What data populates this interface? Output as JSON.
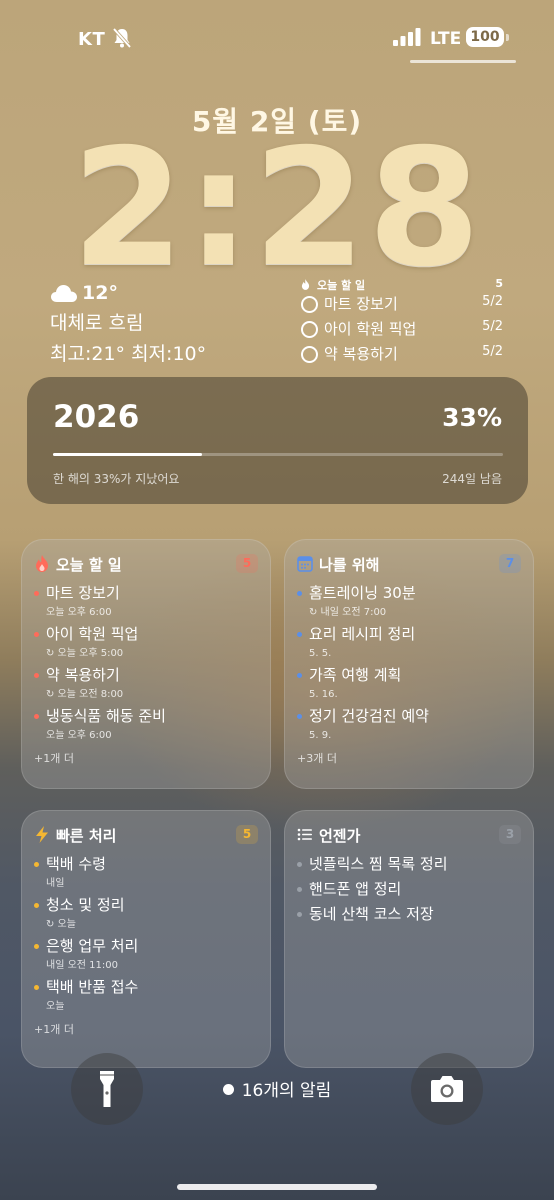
{
  "status_bar": {
    "carrier": "KT",
    "network": "LTE",
    "battery": "100"
  },
  "lock": {
    "date": "5월 2일 (토)",
    "time": "2:28"
  },
  "weather": {
    "temp": "12°",
    "condition": "대체로 흐림",
    "range": "최고:21° 최저:10°"
  },
  "today_mini": {
    "title": "오늘 할 일",
    "count": "5",
    "items": [
      {
        "label": "마트 장보기",
        "date": "5/2"
      },
      {
        "label": "아이 학원 픽업",
        "date": "5/2"
      },
      {
        "label": "약 복용하기",
        "date": "5/2"
      }
    ]
  },
  "year_widget": {
    "year": "2026",
    "percent": "33%",
    "progress": 0.33,
    "caption": "한 해의 33%가 지났어요",
    "remaining": "244일 남음"
  },
  "lists": [
    {
      "title": "오늘 할 일",
      "count": "5",
      "icon": "flame-icon",
      "color": "#ff6b5a",
      "items": [
        {
          "label": "마트 장보기",
          "sub": "오늘 오후 6:00"
        },
        {
          "label": "아이 학원 픽업",
          "sub": "↻ 오늘 오후 5:00"
        },
        {
          "label": "약 복용하기",
          "sub": "↻ 오늘 오전 8:00"
        },
        {
          "label": "냉동식품 해동 준비",
          "sub": "오늘 오후 6:00"
        }
      ],
      "more": "+1개 더"
    },
    {
      "title": "나를 위해",
      "count": "7",
      "icon": "calendar-icon",
      "color": "#5b8fe8",
      "items": [
        {
          "label": "홈트레이닝 30분",
          "sub": "↻ 내일 오전 7:00"
        },
        {
          "label": "요리 레시피 정리",
          "sub": "5. 5."
        },
        {
          "label": "가족 여행 계획",
          "sub": "5. 16."
        },
        {
          "label": "정기 건강검진 예약",
          "sub": "5. 9."
        }
      ],
      "more": "+3개 더"
    },
    {
      "title": "빠른 처리",
      "count": "5",
      "icon": "bolt-icon",
      "color": "#f5b731",
      "items": [
        {
          "label": "택배 수령",
          "sub": "내일"
        },
        {
          "label": "청소 및 정리",
          "sub": "↻ 오늘"
        },
        {
          "label": "은행 업무 처리",
          "sub": "내일 오전 11:00"
        },
        {
          "label": "택배 반품 접수",
          "sub": "오늘"
        }
      ],
      "more": "+1개 더"
    },
    {
      "title": "언젠가",
      "count": "3",
      "icon": "list-icon",
      "color": "#9aa0a8",
      "items": [
        {
          "label": "넷플릭스 찜 목록 정리",
          "sub": ""
        },
        {
          "label": "핸드폰 앱 정리",
          "sub": ""
        },
        {
          "label": "동네 산책 코스 저장",
          "sub": ""
        }
      ],
      "more": ""
    }
  ],
  "notifications": {
    "label": "16개의 알림"
  }
}
